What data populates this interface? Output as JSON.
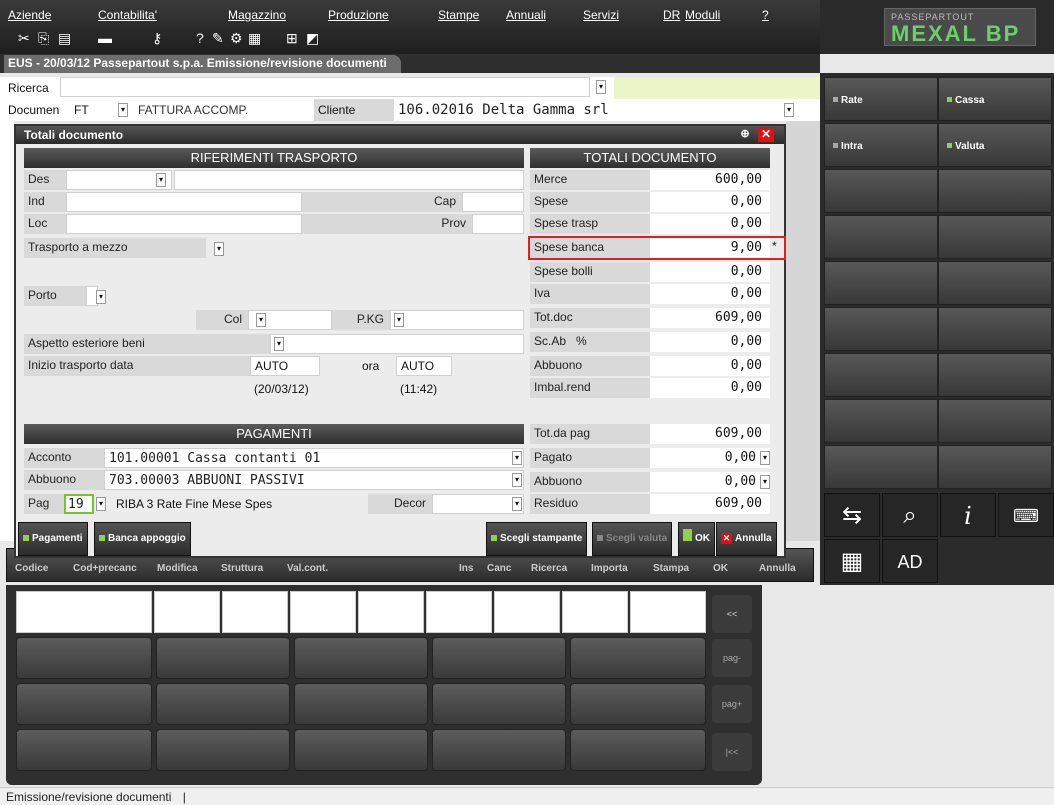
{
  "menu": {
    "items": [
      "Aziende",
      "Contabilita'",
      "Magazzino",
      "Produzione",
      "Stampe",
      "Annuali",
      "Servizi",
      "DR",
      "Moduli",
      "?"
    ]
  },
  "toolbar": {
    "icons": [
      "scissors-icon",
      "copy-icon",
      "paste-icon",
      "print-icon",
      "key-icon",
      "help-icon",
      "edit-icon",
      "settings-icon",
      "calculator-icon",
      "expand-icon",
      "window-icon"
    ]
  },
  "logo": {
    "line1": "PASSEPARTOUT",
    "line2": "MEXAL BP"
  },
  "window": {
    "title": "EUS - 20/03/12 Passepartout s.p.a. Emissione/revisione documenti"
  },
  "form": {
    "ricerca_label": "Ricerca",
    "documen_label": "Documen",
    "doc_type": "FT",
    "doc_desc": "FATTURA ACCOMP.",
    "cliente_label": "Cliente",
    "cliente_value": "106.02016 Delta Gamma srl"
  },
  "right_panel": {
    "btn_rate": "Rate",
    "btn_cassa": "Cassa",
    "btn_intra": "Intra",
    "btn_valuta": "Valuta",
    "btn_ad": "AD"
  },
  "dialog": {
    "title": "Totali documento",
    "rif_trasporto": {
      "header": "RIFERIMENTI TRASPORTO",
      "des": "Des",
      "ind": "Ind",
      "cap": "Cap",
      "loc": "Loc",
      "prov": "Prov",
      "trasporto": "Trasporto a mezzo",
      "porto": "Porto",
      "col": "Col",
      "pkg": "P.KG",
      "aspetto": "Aspetto esteriore beni",
      "inizio": "Inizio trasporto  data",
      "data_value": "AUTO",
      "data_paren": "(20/03/12)",
      "ora_label": "ora",
      "ora_value": "AUTO",
      "ora_paren": "(11:42)"
    },
    "totali": {
      "header": "TOTALI DOCUMENTO",
      "rows": [
        {
          "label": "Merce",
          "value": "600,00"
        },
        {
          "label": "Spese",
          "value": "0,00"
        },
        {
          "label": "Spese trasp",
          "value": "0,00"
        },
        {
          "label": "Spese banca",
          "value": "9,00",
          "mark": "*"
        },
        {
          "label": "Spese bolli",
          "value": "0,00"
        },
        {
          "label": "Iva",
          "value": "0,00"
        },
        {
          "label": "Tot.doc",
          "value": "609,00"
        },
        {
          "label": "Sc.Ab   %",
          "value": "0,00"
        },
        {
          "label": "Abbuono",
          "value": "0,00"
        },
        {
          "label": "Imbal.rend",
          "value": "0,00"
        }
      ],
      "totda_label": "Tot.da pag",
      "totda_value": "609,00",
      "pagato_label": "Pagato",
      "pagato_value": "0,00",
      "abbuono_label": "Abbuono",
      "abbuono_value": "0,00",
      "residuo_label": "Residuo",
      "residuo_value": "609,00"
    },
    "pagamenti": {
      "header": "PAGAMENTI",
      "acconto_label": "Acconto",
      "acconto_value": "101.00001 Cassa contanti 01",
      "abbuono_label": "Abbuono",
      "abbuono_value": "703.00003 ABBUONI PASSIVI",
      "pag_label": "Pag",
      "pag_code": "19",
      "pag_desc": "RIBA 3 Rate Fine Mese Spes",
      "decor_label": "Decor"
    },
    "footer": {
      "pagamenti": "Pagamenti",
      "banca": "Banca appoggio",
      "scegli_stampante": "Scegli stampante",
      "scegli_valuta": "Scegli valuta",
      "ok": "OK",
      "annulla": "Annulla"
    }
  },
  "bottom_bar": {
    "left": [
      "Codice",
      "Cod+precanc",
      "Modifica",
      "Struttura",
      "Val.cont."
    ],
    "right": [
      "Ins",
      "Canc",
      "Ricerca",
      "Importa",
      "Stampa",
      "OK",
      "Annulla"
    ]
  },
  "keypad": {
    "side": [
      "<<",
      "pag-",
      "pag+",
      "|<<"
    ]
  },
  "status": {
    "text": "Emissione/revisione documenti"
  }
}
